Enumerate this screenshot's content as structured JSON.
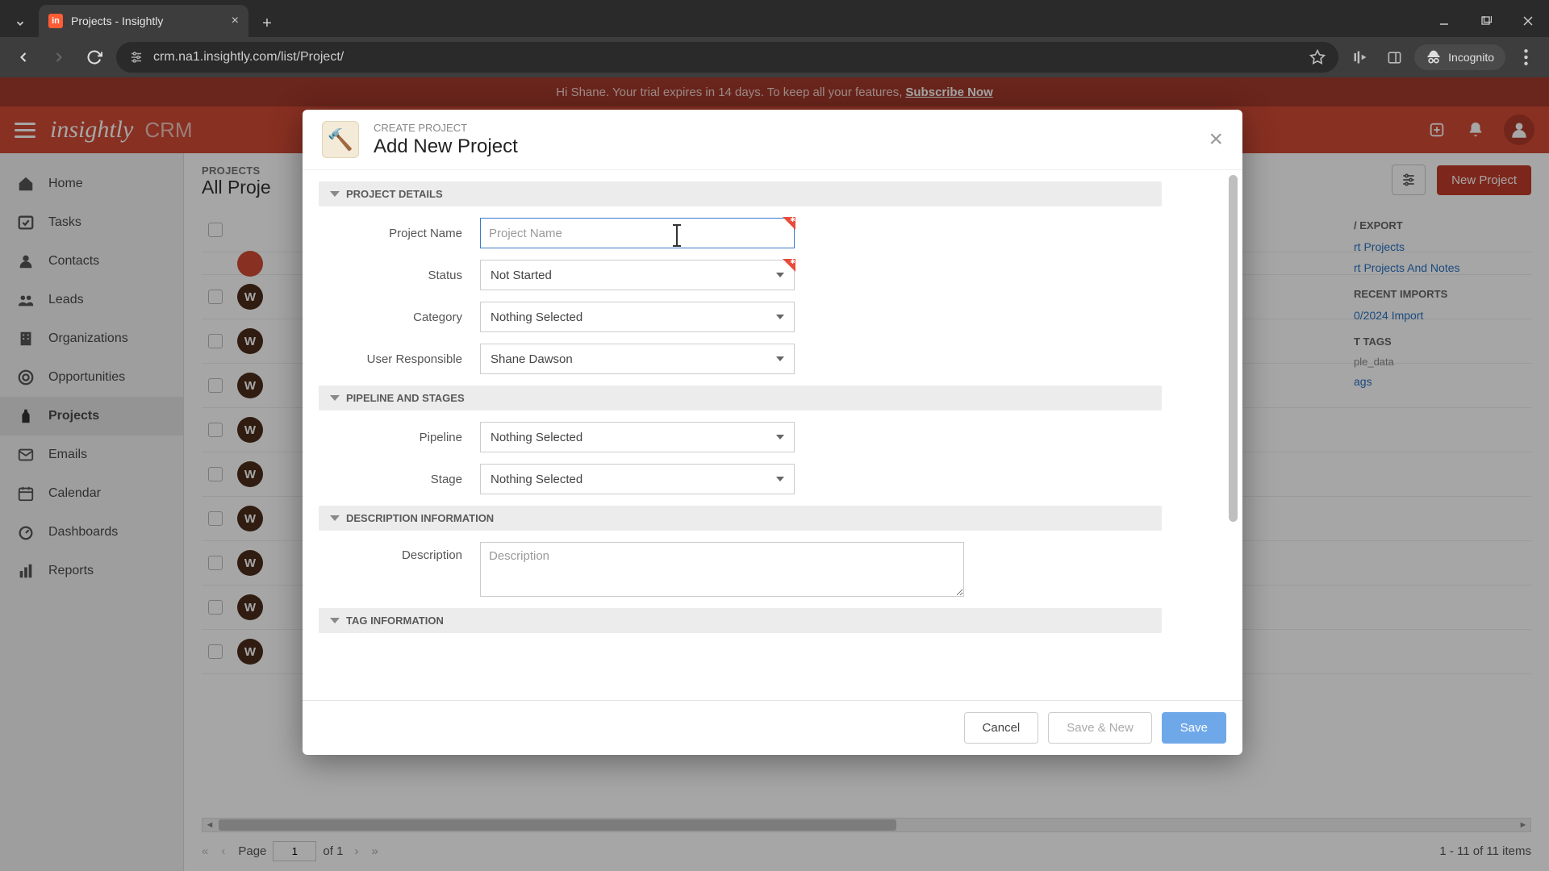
{
  "browser": {
    "tab_title": "Projects - Insightly",
    "url": "crm.na1.insightly.com/list/Project/",
    "incognito_label": "Incognito"
  },
  "banner": {
    "text_prefix": "Hi Shane. Your trial expires in 14 days. To keep all your features, ",
    "link": "Subscribe Now"
  },
  "header": {
    "logo": "insightly",
    "product": "CRM"
  },
  "sidebar": {
    "items": [
      {
        "label": "Home"
      },
      {
        "label": "Tasks"
      },
      {
        "label": "Contacts"
      },
      {
        "label": "Leads"
      },
      {
        "label": "Organizations"
      },
      {
        "label": "Opportunities"
      },
      {
        "label": "Projects"
      },
      {
        "label": "Emails"
      },
      {
        "label": "Calendar"
      },
      {
        "label": "Dashboards"
      },
      {
        "label": "Reports"
      }
    ]
  },
  "main": {
    "supertitle": "PROJECTS",
    "title": "All Proje",
    "new_button": "New Project",
    "row_initial": "W",
    "pager_label_page": "Page",
    "pager_page_value": "1",
    "pager_of": "of 1",
    "pager_summary": "1 - 11 of 11 items"
  },
  "right_panel": {
    "export_head": "/ EXPORT",
    "link1": "rt Projects",
    "link2": "rt Projects And Notes",
    "recent_head": "RECENT IMPORTS",
    "recent_item": "0/2024 Import",
    "tags_head": "T TAGS",
    "tag_muted": "ple_data",
    "tag_link": "ags"
  },
  "modal": {
    "supertitle": "CREATE PROJECT",
    "title": "Add New Project",
    "sections": {
      "details": "PROJECT DETAILS",
      "pipeline": "PIPELINE AND STAGES",
      "description": "DESCRIPTION INFORMATION",
      "tags": "TAG INFORMATION"
    },
    "labels": {
      "project_name": "Project Name",
      "status": "Status",
      "category": "Category",
      "user_responsible": "User Responsible",
      "pipeline": "Pipeline",
      "stage": "Stage",
      "description": "Description"
    },
    "placeholders": {
      "project_name": "Project Name",
      "description": "Description"
    },
    "values": {
      "status": "Not Started",
      "category": "Nothing Selected",
      "user_responsible": "Shane Dawson",
      "pipeline": "Nothing Selected",
      "stage": "Nothing Selected"
    },
    "buttons": {
      "cancel": "Cancel",
      "save_new": "Save & New",
      "save": "Save"
    }
  }
}
